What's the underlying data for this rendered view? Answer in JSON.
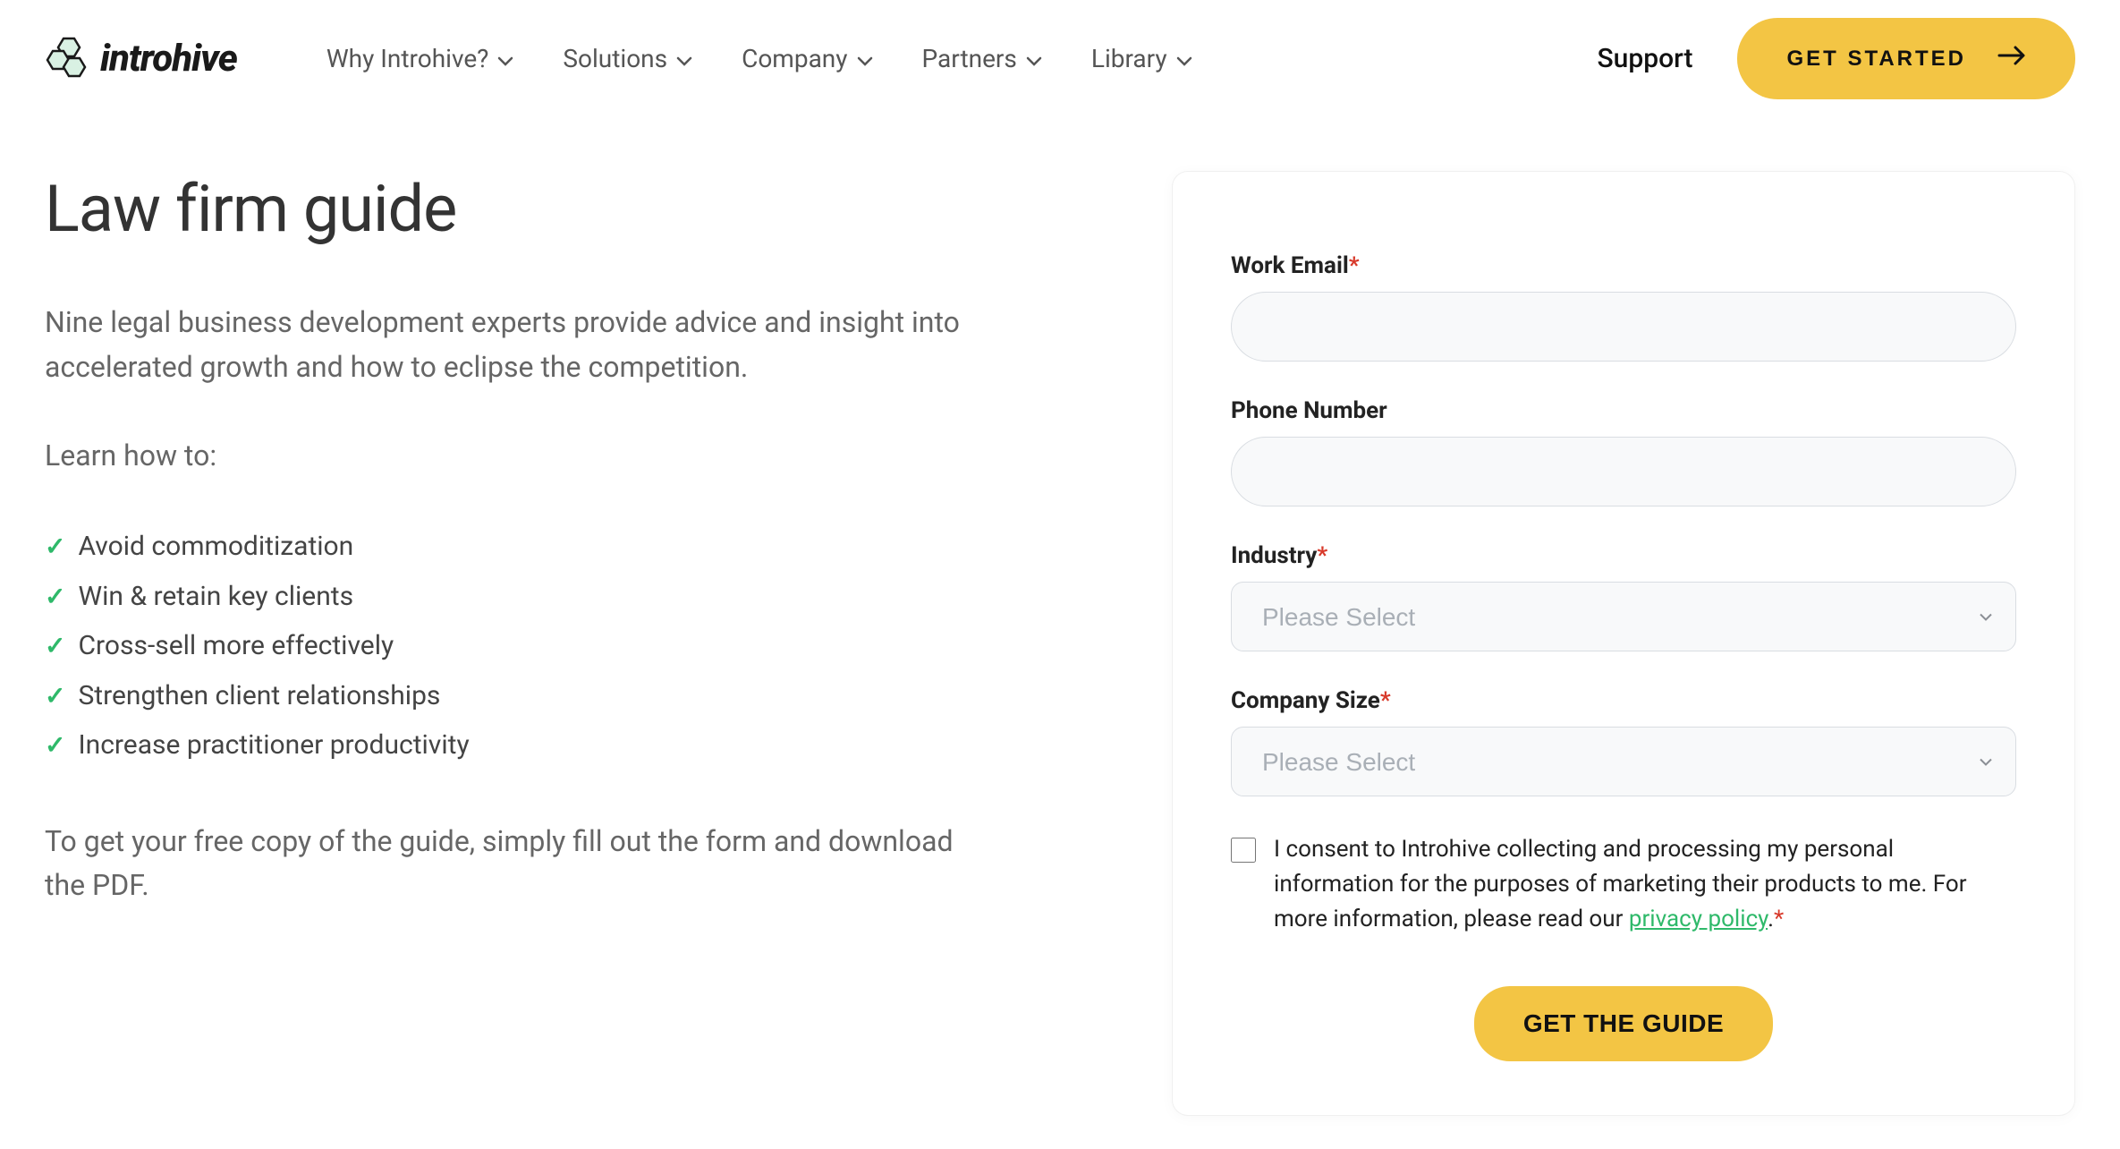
{
  "header": {
    "logo_text": "introhive",
    "nav": [
      {
        "label": "Why Introhive?"
      },
      {
        "label": "Solutions"
      },
      {
        "label": "Company"
      },
      {
        "label": "Partners"
      },
      {
        "label": "Library"
      }
    ],
    "support_label": "Support",
    "cta_label": "GET STARTED"
  },
  "content": {
    "title": "Law firm guide",
    "intro": "Nine legal business development experts provide advice and insight into accelerated growth and how to eclipse the competition.",
    "learn_label": "Learn how to:",
    "bullets": [
      "Avoid commoditization",
      "Win & retain key clients",
      "Cross-sell more effectively",
      "Strengthen client relationships",
      "Increase practitioner productivity"
    ],
    "closing": "To get your free copy of the guide, simply fill out the form and download the PDF."
  },
  "form": {
    "email_label": "Work Email",
    "email_required": true,
    "email_value": "",
    "phone_label": "Phone Number",
    "phone_required": false,
    "phone_value": "",
    "industry_label": "Industry",
    "industry_required": true,
    "industry_placeholder": "Please Select",
    "company_size_label": "Company Size",
    "company_size_required": true,
    "company_size_placeholder": "Please Select",
    "consent_text_1": "I consent to Introhive collecting and processing my personal information for the purposes of marketing their products to me. For more information, please read our ",
    "privacy_link_text": "privacy policy",
    "consent_text_2": ".",
    "consent_required": true,
    "submit_label": "GET THE GUIDE"
  }
}
